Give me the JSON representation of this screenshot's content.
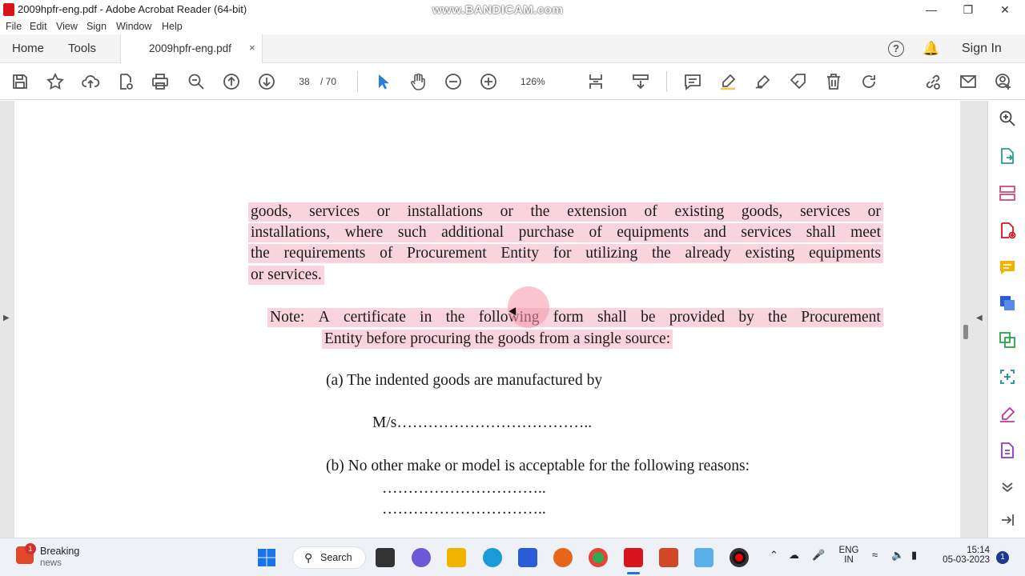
{
  "window": {
    "title": "2009hpfr-eng.pdf - Adobe Acrobat Reader (64-bit)",
    "watermark": "www.BANDICAM.com",
    "minimize": "—",
    "restore": "❐",
    "close": "✕"
  },
  "menu": [
    "File",
    "Edit",
    "View",
    "Sign",
    "Window",
    "Help"
  ],
  "tabs": {
    "home": "Home",
    "tools": "Tools",
    "document": "2009hpfr-eng.pdf",
    "close": "×",
    "help": "?",
    "sign_in": "Sign In"
  },
  "toolbar": {
    "current_page": "38",
    "page_separator": "/ 70",
    "zoom": "126%"
  },
  "document": {
    "para1_lines": [
      [
        "goods,",
        "services",
        "or",
        "installations",
        "or",
        "the",
        "extension",
        "of",
        "existing",
        "goods,",
        "services",
        "or"
      ],
      [
        "installations,",
        "where",
        "such",
        "additional",
        "purchase",
        "of",
        "equipments",
        "and",
        "services",
        "shall",
        "meet"
      ],
      [
        "the",
        "requirements",
        "of",
        "Procurement",
        "Entity",
        "for",
        "utilizing",
        "the",
        "already",
        "existing",
        "equipments"
      ]
    ],
    "para1_last": "or services.",
    "note_line1": [
      "Note:",
      "A",
      "certificate",
      "in",
      "the",
      "following",
      "form",
      "shall",
      "be",
      "provided",
      "by",
      "the",
      "Procurement"
    ],
    "note_line2": "Entity before procuring the goods from a single source:",
    "item_a": "(a)  The indented goods are manufactured by",
    "ms_line": "M/s………………………………..",
    "item_b": "(b)  No other make or model is acceptable for the following reasons:",
    "dots1": "…………………………..",
    "dots2": "………………………….."
  },
  "taskbar": {
    "news_title": "Breaking",
    "news_sub": "news",
    "news_badge": "1",
    "search_label": "Search",
    "lang_line1": "ENG",
    "lang_line2": "IN",
    "time": "15:14",
    "date": "05-03-2023",
    "notification_count": "1"
  },
  "colors": {
    "highlight": "#f9d4dc",
    "acrobat_red": "#d8141c",
    "icon_blue": "#2a7dd8",
    "icon_gray": "#555555"
  }
}
